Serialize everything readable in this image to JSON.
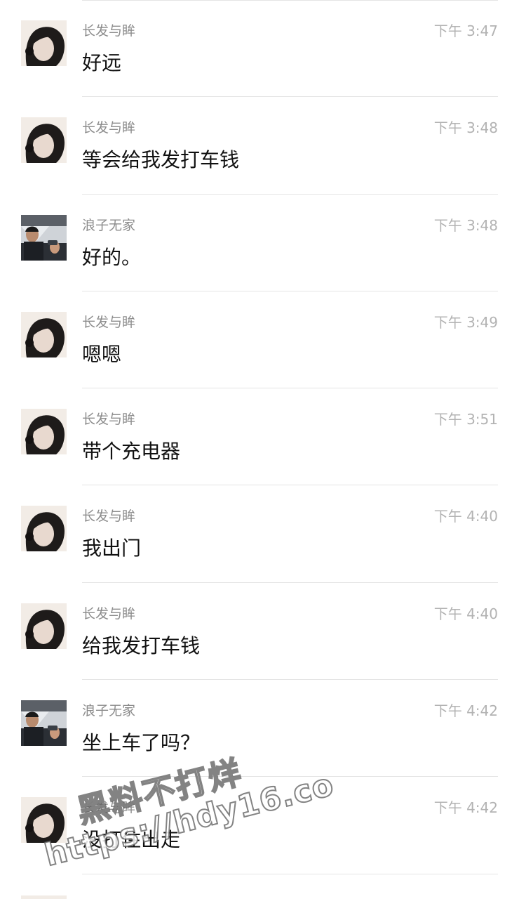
{
  "conversation": {
    "messages": [
      {
        "sender": "长发与眸",
        "avatar": "long-hair-avatar",
        "time": "下午 3:47",
        "text": "好远"
      },
      {
        "sender": "长发与眸",
        "avatar": "long-hair-avatar",
        "time": "下午 3:48",
        "text": "等会给我发打车钱"
      },
      {
        "sender": "浪子无家",
        "avatar": "car-driver-avatar",
        "time": "下午 3:48",
        "text": "好的。"
      },
      {
        "sender": "长发与眸",
        "avatar": "long-hair-avatar",
        "time": "下午 3:49",
        "text": "嗯嗯"
      },
      {
        "sender": "长发与眸",
        "avatar": "long-hair-avatar",
        "time": "下午 3:51",
        "text": "带个充电器"
      },
      {
        "sender": "长发与眸",
        "avatar": "long-hair-avatar",
        "time": "下午 4:40",
        "text": "我出门"
      },
      {
        "sender": "长发与眸",
        "avatar": "long-hair-avatar",
        "time": "下午 4:40",
        "text": "给我发打车钱"
      },
      {
        "sender": "浪子无家",
        "avatar": "car-driver-avatar",
        "time": "下午 4:42",
        "text": "坐上车了吗？"
      },
      {
        "sender": "长发与眸",
        "avatar": "long-hair-avatar",
        "time": "下午 4:42",
        "text": "没打住出走"
      }
    ]
  },
  "watermark": {
    "line1": "黑料不打烊",
    "line2": "https://hdy16.co"
  },
  "colors": {
    "divider": "#e4e4e4",
    "name": "#8c8c8c",
    "time": "#b3b3b3",
    "message": "#111111"
  }
}
